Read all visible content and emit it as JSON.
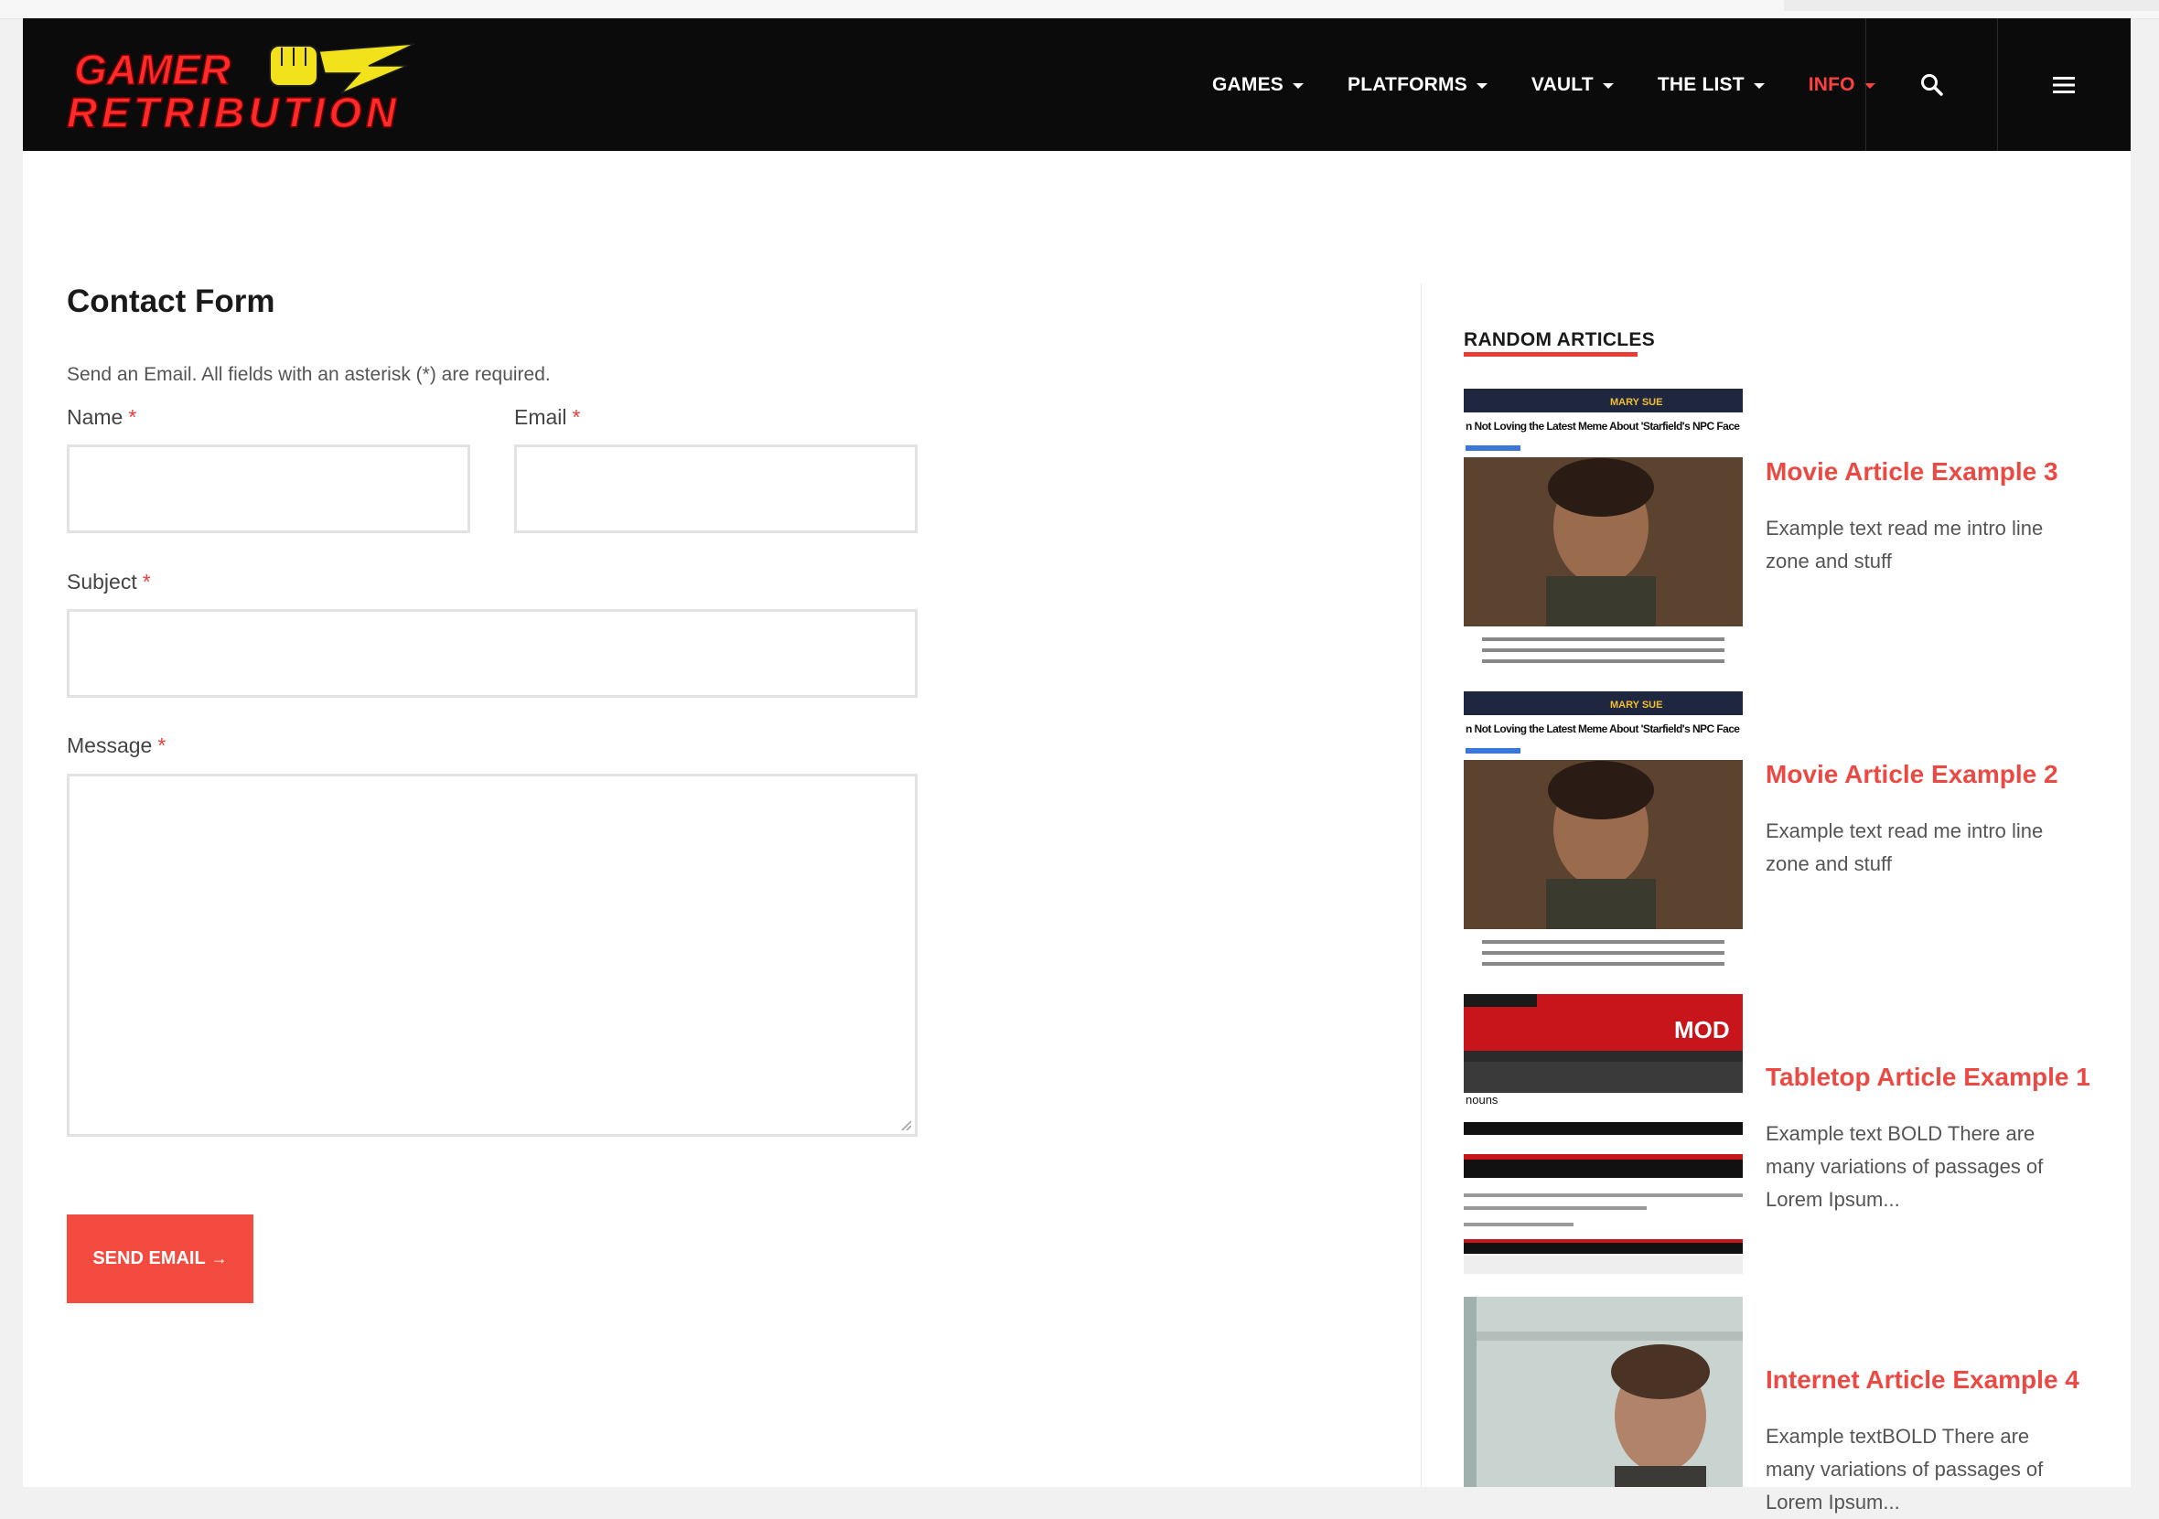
{
  "brand": {
    "line1": "GAMER",
    "line2": "RETRIBUTION"
  },
  "nav": {
    "items": [
      {
        "label": "GAMES"
      },
      {
        "label": "PLATFORMS"
      },
      {
        "label": "VAULT"
      },
      {
        "label": "THE LIST"
      },
      {
        "label": "INFO"
      }
    ],
    "active_index": 4
  },
  "header_icons": [
    "search-icon",
    "hamburger-menu-icon"
  ],
  "colors": {
    "header_bg": "#0b0b0c",
    "accent": "#ea4a43",
    "button_bg": "#f44b41",
    "logo_red": "#ff2a2a",
    "logo_yellow": "#f2e21b"
  },
  "form": {
    "title": "Contact Form",
    "intro": "Send an Email. All fields with an asterisk (*) are required.",
    "required_mark": "*",
    "name_label": "Name",
    "email_label": "Email",
    "subject_label": "Subject",
    "message_label": "Message",
    "name_value": "",
    "email_value": "",
    "subject_value": "",
    "message_value": "",
    "submit_label": "SEND EMAIL",
    "submit_arrow": "→"
  },
  "sidebar": {
    "heading": "RANDOM ARTICLES",
    "articles": [
      {
        "title": "Movie Article Example 3",
        "excerpt": "Example text read me intro line zone and stuff",
        "thumb_caption_brand": "MARY SUE",
        "thumb_caption_headline": "n Not Loving the Latest Meme About 'Starfield's NPC Face"
      },
      {
        "title": "Movie Article Example 2",
        "excerpt": "Example text read me intro line zone and stuff",
        "thumb_caption_brand": "MARY SUE",
        "thumb_caption_headline": "n Not Loving the Latest Meme About 'Starfield's NPC Face"
      },
      {
        "title": "Tabletop Article Example 1",
        "excerpt": "Example text BOLD There are many variations of passages of Lorem Ipsum...",
        "thumb_caption_brand": "MOD",
        "thumb_caption_headline": "nouns"
      },
      {
        "title": "Internet Article Example 4",
        "excerpt": "Example textBOLD There are many variations of passages of Lorem Ipsum...",
        "thumb_caption_brand": "",
        "thumb_caption_headline": ""
      }
    ]
  }
}
